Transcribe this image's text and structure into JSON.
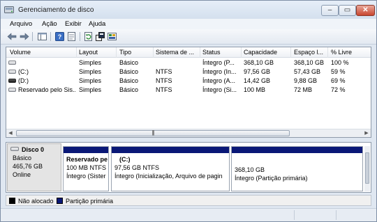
{
  "window": {
    "title": "Gerenciamento de disco"
  },
  "menu": {
    "items": [
      "Arquivo",
      "Ação",
      "Exibir",
      "Ajuda"
    ]
  },
  "toolbar": {
    "buttons": [
      "back-arrow-icon",
      "forward-arrow-icon",
      "show-hide-tree-icon",
      "help-icon",
      "properties-icon",
      "refresh-icon",
      "export-icon",
      "disk-settings-icon"
    ]
  },
  "volume_list": {
    "columns": [
      "Volume",
      "Layout",
      "Tipo",
      "Sistema de ...",
      "Status",
      "Capacidade",
      "Espaço l...",
      "% Livre"
    ],
    "rows": [
      {
        "volume": "",
        "layout": "Simples",
        "tipo": "Básico",
        "sistema": "",
        "status": "Íntegro (P...",
        "capacidade": "368,10 GB",
        "espaco": "368,10 GB",
        "livre": "100 %"
      },
      {
        "volume": "(C:)",
        "layout": "Simples",
        "tipo": "Básico",
        "sistema": "NTFS",
        "status": "Íntegro (In...",
        "capacidade": "97,56 GB",
        "espaco": "57,43 GB",
        "livre": "59 %"
      },
      {
        "volume": "(D:)",
        "layout": "Simples",
        "tipo": "Básico",
        "sistema": "NTFS",
        "status": "Íntegro (A...",
        "capacidade": "14,42 GB",
        "espaco": "9,88 GB",
        "livre": "69 %"
      },
      {
        "volume": "Reservado pelo Sis...",
        "layout": "Simples",
        "tipo": "Básico",
        "sistema": "NTFS",
        "status": "Íntegro (Si...",
        "capacidade": "100 MB",
        "espaco": "72 MB",
        "livre": "72 %"
      }
    ],
    "scroll_grip": "|||"
  },
  "disk": {
    "name": "Disco 0",
    "type": "Básico",
    "size": "465,76 GB",
    "state": "Online",
    "partitions": [
      {
        "name": "Reservado pe",
        "size": "100 MB NTFS",
        "status": "Íntegro (Sister"
      },
      {
        "name": "(C:)",
        "size": "97,56 GB NTFS",
        "status": "Íntegro (Inicialização, Arquivo de pagin"
      },
      {
        "name": "",
        "size": "368,10 GB",
        "status": "Íntegro (Partição primária)"
      }
    ]
  },
  "legend": {
    "items": [
      {
        "label": "Não alocado",
        "color": "#000000"
      },
      {
        "label": "Partição primária",
        "color": "#0a1877"
      }
    ]
  }
}
